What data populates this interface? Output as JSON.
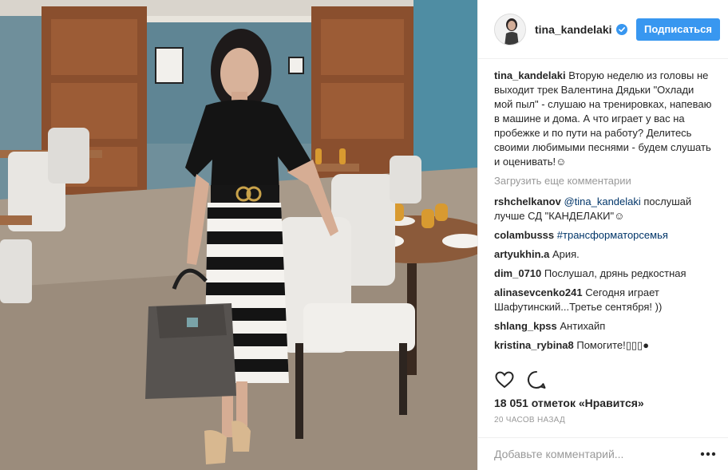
{
  "post": {
    "photo_alt": "",
    "header": {
      "username": "tina_kandelaki",
      "verified_icon": "verified-badge-icon",
      "follow_label": "Подписаться"
    },
    "caption": {
      "username": "tina_kandelaki",
      "text": "Вторую неделю из головы не выходит трек Валентина Дядьки \"Охлади мой пыл\" - слушаю на тренировках, напеваю в машине и дома. А что играет у вас на пробежке и по пути на работу? Делитесь своими любимыми песнями - будем слушать и оценивать!☺"
    },
    "load_more_label": "Загрузить еще комментарии",
    "comments": [
      {
        "username": "rshchelkanov",
        "mention": "@tina_kandelaki",
        "text": " послушай лучше СД \"КАНДЕЛАКИ\"☺"
      },
      {
        "username": "colambusss",
        "tag": "#трансформаторсемья",
        "text": ""
      },
      {
        "username": "artyukhin.a",
        "text": "Ария."
      },
      {
        "username": "dim_0710",
        "text": "Послушал, дрянь редкостная"
      },
      {
        "username": "alinasevcenko241",
        "text": "Сегодня играет Шафутинский...Третье сентября! ))"
      },
      {
        "username": "shlang_kpss",
        "text": "Антихайп"
      },
      {
        "username": "kristina_rybina8",
        "text": "Помогите!▯▯▯●"
      }
    ],
    "actions": {
      "like_icon": "heart-icon",
      "comment_icon": "comment-bubble-icon"
    },
    "likes_text": "18 051 отметок «Нравится»",
    "time_text": "20 ЧАСОВ НАЗАД",
    "add_comment_placeholder": "Добавьте комментарий...",
    "more_icon": "more-options-icon",
    "colors": {
      "accent": "#3897f0",
      "link": "#003569",
      "muted": "#999999",
      "text": "#262626",
      "border": "#efefef"
    }
  }
}
